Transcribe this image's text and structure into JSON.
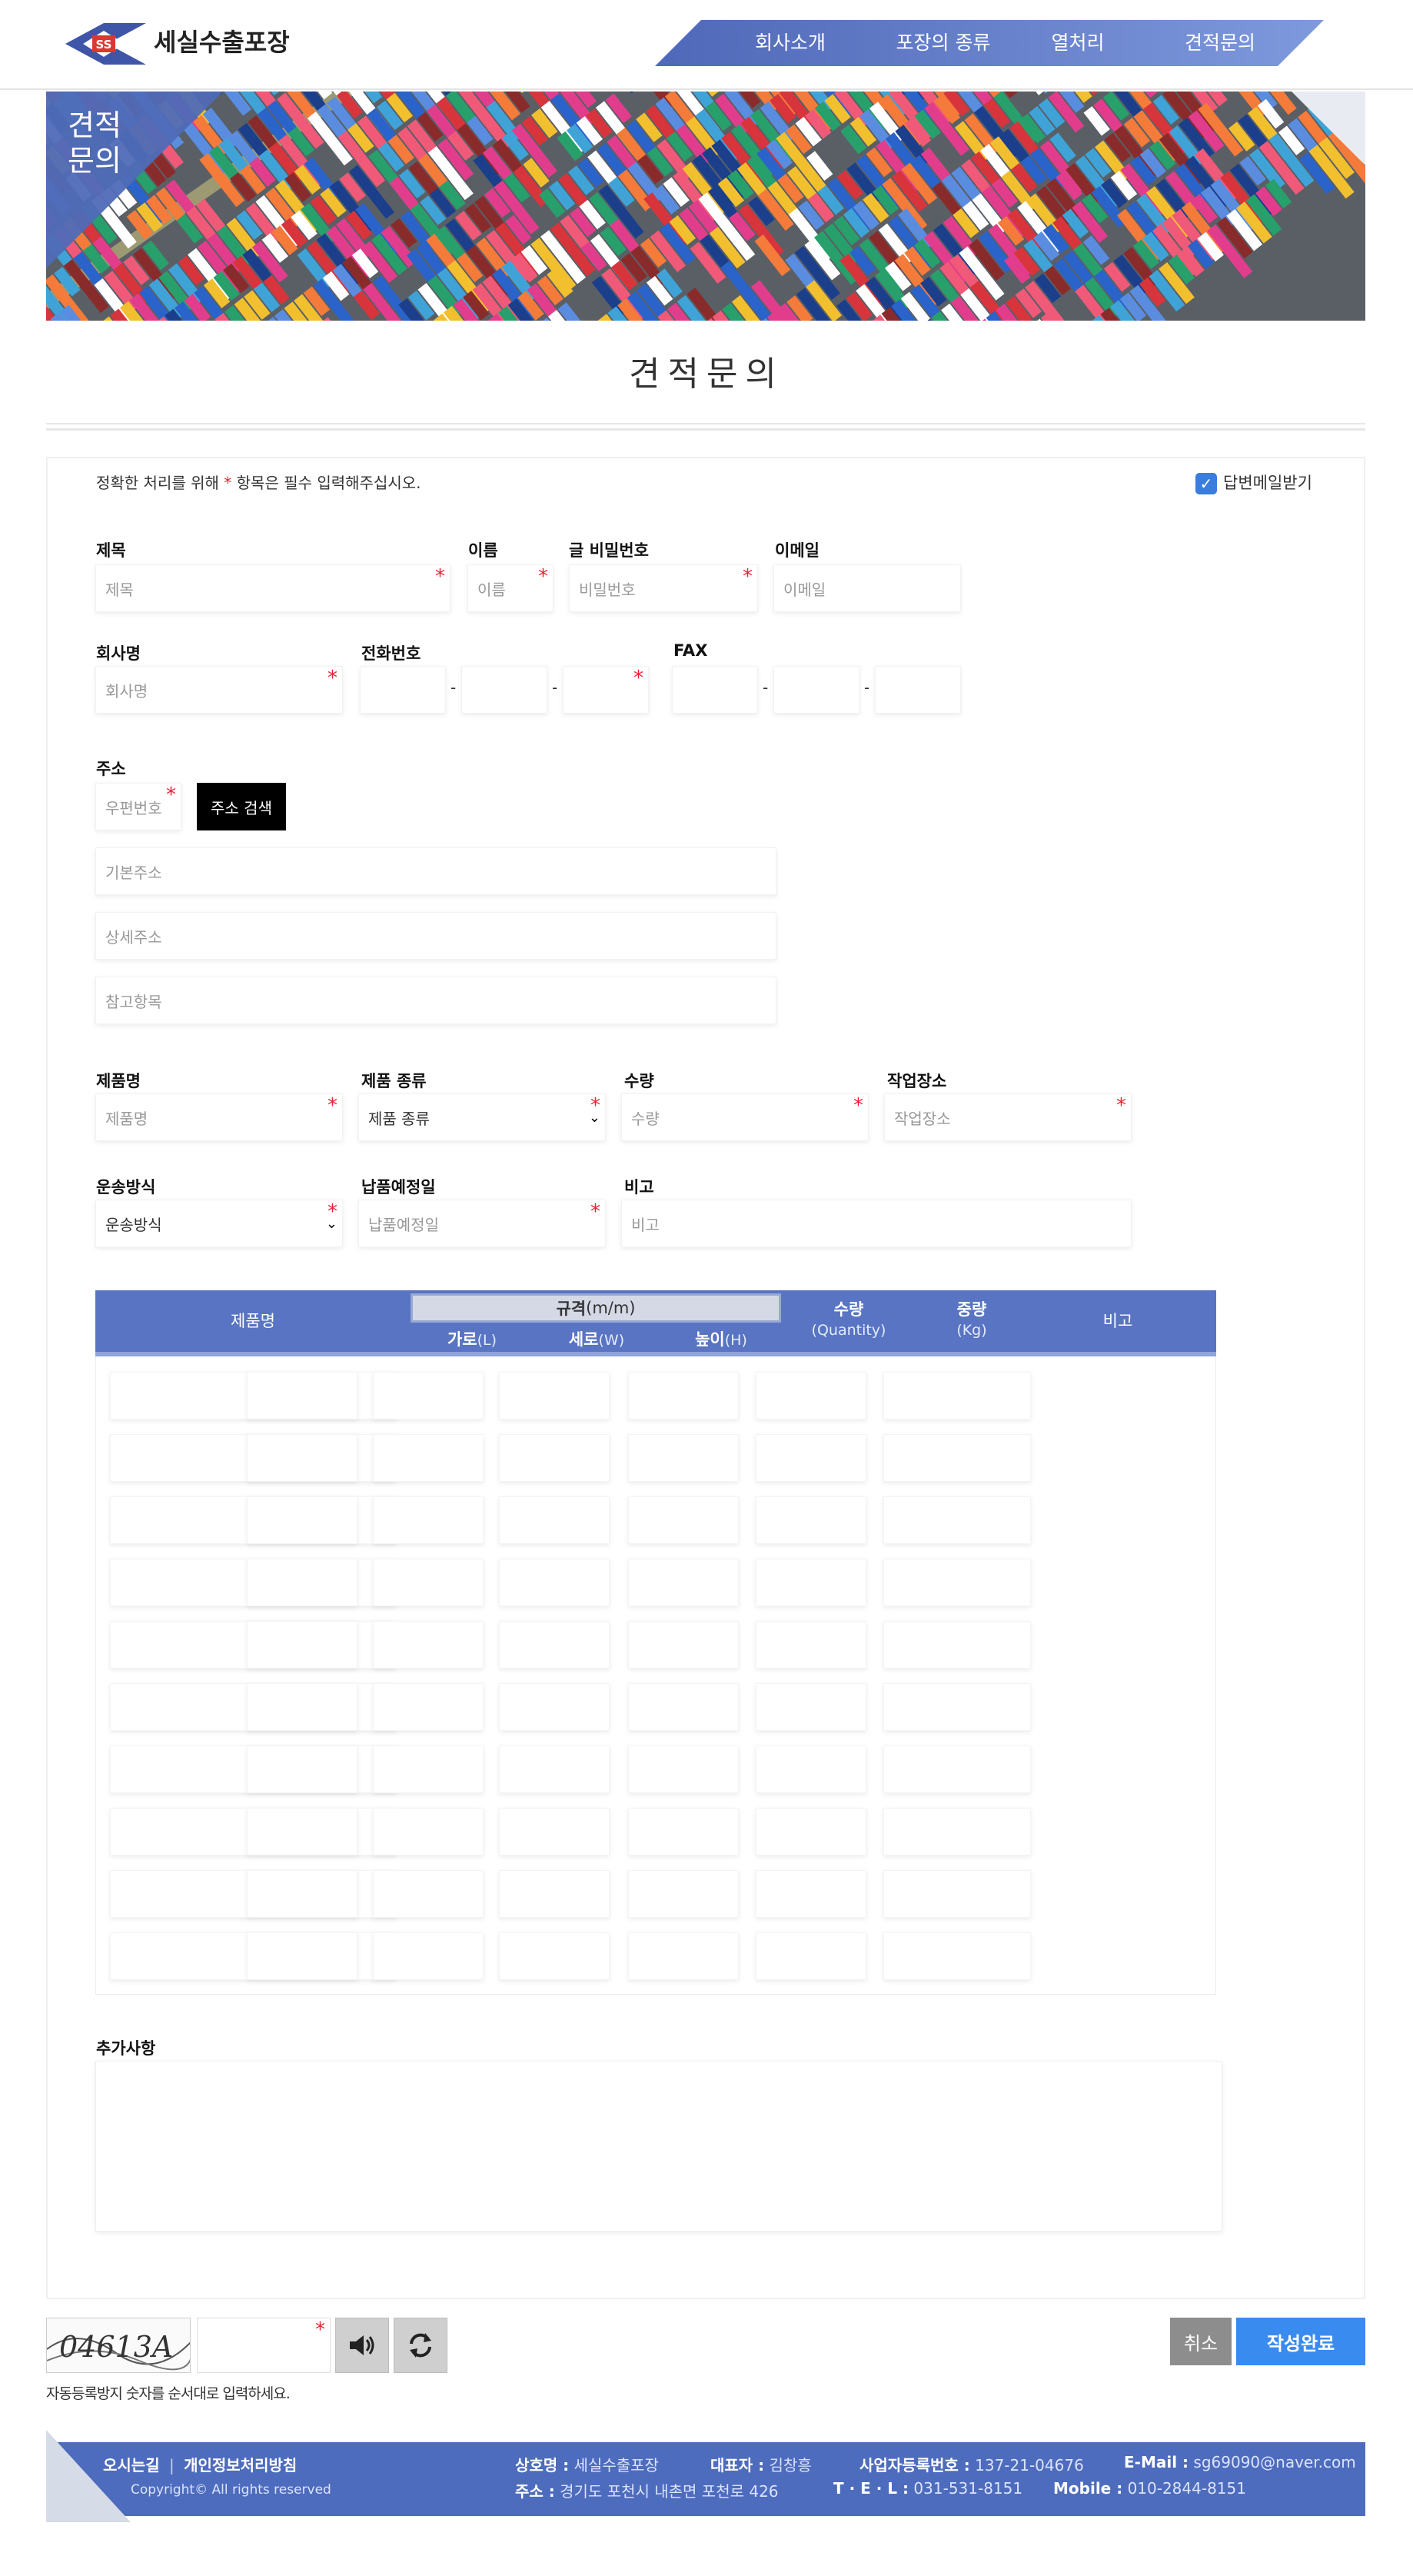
{
  "header": {
    "logo_badge": "SS",
    "logo_text": "세실수출포장",
    "nav": [
      {
        "label": "회사소개"
      },
      {
        "label": "포장의 종류"
      },
      {
        "label": "열처리"
      },
      {
        "label": "견적문의"
      }
    ]
  },
  "banner": {
    "label_line1": "견적",
    "label_line2": "문의"
  },
  "page_title": "견적문의",
  "notice": {
    "before": "정확한 처리를 위해 ",
    "star": "*",
    "after": " 항목은 필수 입력해주십시오."
  },
  "reply_email": {
    "label": "답변메일받기",
    "checked": true
  },
  "fields": {
    "title": {
      "label": "제목",
      "placeholder": "제목"
    },
    "name": {
      "label": "이름",
      "placeholder": "이름"
    },
    "password": {
      "label": "글 비밀번호",
      "placeholder": "비밀번호"
    },
    "email": {
      "label": "이메일",
      "placeholder": "이메일"
    },
    "company": {
      "label": "회사명",
      "placeholder": "회사명"
    },
    "phone": {
      "label": "전화번호"
    },
    "fax": {
      "label": "FAX"
    },
    "address": {
      "label": "주소",
      "zip_placeholder": "우편번호",
      "search_button": "주소 검색",
      "basic_placeholder": "기본주소",
      "detail_placeholder": "상세주소",
      "extra_placeholder": "참고항목"
    },
    "product_name": {
      "label": "제품명",
      "placeholder": "제품명"
    },
    "product_type": {
      "label": "제품 종류",
      "value": "제품 종류"
    },
    "quantity": {
      "label": "수량",
      "placeholder": "수량"
    },
    "work_place": {
      "label": "작업장소",
      "placeholder": "작업장소"
    },
    "shipping": {
      "label": "운송방식",
      "value": "운송방식"
    },
    "delivery_date": {
      "label": "납품예정일",
      "placeholder": "납품예정일"
    },
    "remarks": {
      "label": "비고",
      "placeholder": "비고"
    }
  },
  "dash": "-",
  "req": "*",
  "product_table": {
    "col_product": "제품명",
    "spec_main": "규격",
    "spec_unit": "(m/m)",
    "width_label": "가로",
    "width_unit": "(L)",
    "depth_label": "세로",
    "depth_unit": "(W)",
    "height_label": "높이",
    "height_unit": "(H)",
    "qty_label": "수량",
    "qty_unit": "(Quantity)",
    "weight_label": "중량",
    "weight_unit": "(Kg)",
    "remarks_label": "비고",
    "row_count": 10
  },
  "additional": {
    "label": "추가사항"
  },
  "captcha": {
    "image_text": "04613A",
    "note": "자동등록방지 숫자를 순서대로 입력하세요."
  },
  "buttons": {
    "cancel": "취소",
    "submit": "작성완료"
  },
  "footer": {
    "link_directions": "오시는길",
    "separator": "|",
    "link_privacy": "개인정보처리방침",
    "copyright": "Copyright© All rights reserved",
    "company_label": "상호명 :",
    "company_value": "세실수출포장",
    "ceo_label": "대표자 :",
    "ceo_value": "김창흥",
    "biz_label": "사업자등록번호 :",
    "biz_value": "137-21-04676",
    "email_label": "E-Mail :",
    "email_value": "sg69090@naver.com",
    "addr_label": "주소 :",
    "addr_value": "경기도 포천시 내촌면 포천로 426",
    "tel_label": "T · E · L :",
    "tel_value": "031-531-8151",
    "mobile_label": "Mobile :",
    "mobile_value": "010-2844-8151"
  },
  "colors": {
    "nav_blue": "#5874c2",
    "footer_blue": "#4e6cbd",
    "submit_blue": "#3a8bf0",
    "required_red": "#e23333"
  }
}
